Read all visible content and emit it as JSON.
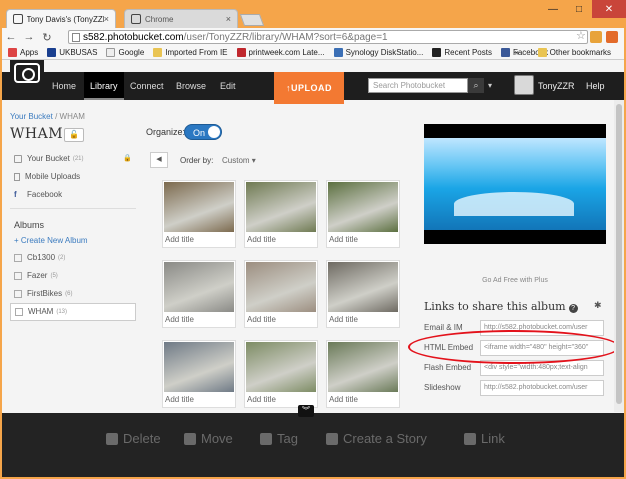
{
  "browser": {
    "tabs": [
      {
        "title": "Tony Davis's (TonyZZR) W"
      },
      {
        "title": "Chrome"
      }
    ],
    "url_host": "s582.photobucket.com",
    "url_path": "/user/TonyZZR/library/WHAM?sort=6&page=1",
    "bookmarks": [
      "Apps",
      "UKBUSAS",
      "Google",
      "Imported From IE",
      "printweek.com Late...",
      "Synology DiskStatio...",
      "Recent Posts",
      "Facebook"
    ],
    "other_bookmarks": "Other bookmarks",
    "bookmarks_more": "»"
  },
  "nav": {
    "items": [
      "Home",
      "Library",
      "Connect",
      "Browse",
      "Edit"
    ],
    "upload": "UPLOAD",
    "search_placeholder": "Search Photobucket",
    "username": "TonyZZR",
    "help": "Help"
  },
  "breadcrumb": {
    "parent": "Your Bucket",
    "separator": "/",
    "current": "WHAM"
  },
  "album_title": "WHAM",
  "organize": {
    "label": "Organize:",
    "state": "On"
  },
  "sidebar": {
    "top": [
      {
        "label": "Your Bucket",
        "count": "(21)"
      },
      {
        "label": "Mobile Uploads",
        "count": ""
      },
      {
        "label": "Facebook",
        "count": ""
      }
    ],
    "albums_heading": "Albums",
    "create": "+ Create New Album",
    "albums": [
      {
        "label": "Cb1300",
        "count": "(2)"
      },
      {
        "label": "Fazer",
        "count": "(5)"
      },
      {
        "label": "FirstBikes",
        "count": "(6)"
      },
      {
        "label": "WHAM",
        "count": "(13)"
      }
    ]
  },
  "order": {
    "label": "Order by:",
    "value": "Custom ▾"
  },
  "thumbs": [
    {
      "caption": "Add title",
      "color": "#7c6a4e"
    },
    {
      "caption": "Add title",
      "color": "#6f7a52"
    },
    {
      "caption": "Add title",
      "color": "#5c7040"
    },
    {
      "caption": "Add title",
      "color": "#8a8a86"
    },
    {
      "caption": "Add title",
      "color": "#9c8e80"
    },
    {
      "caption": "Add title",
      "color": "#6e6a62"
    },
    {
      "caption": "Add title",
      "color": "#6f7a86"
    },
    {
      "caption": "Add title",
      "color": "#7d8c64"
    },
    {
      "caption": "Add title",
      "color": "#6a7a58"
    }
  ],
  "ad_text": "Go Ad Free with Plus",
  "share": {
    "heading": "Links to share this album",
    "rows": [
      {
        "label": "Email & IM",
        "value": "http://s582.photobucket.com/user"
      },
      {
        "label": "HTML Embed",
        "value": "<iframe width=\"480\" height=\"360\""
      },
      {
        "label": "Flash Embed",
        "value": "<div style=\"width:480px;text-align"
      },
      {
        "label": "Slideshow",
        "value": "http://s582.photobucket.com/user"
      }
    ]
  },
  "actions": [
    "Delete",
    "Move",
    "Tag",
    "Create a Story",
    "Link"
  ],
  "colors": {
    "upload": "#f37932",
    "toggle": "#2b78c2",
    "annotation": "#e3121b"
  }
}
